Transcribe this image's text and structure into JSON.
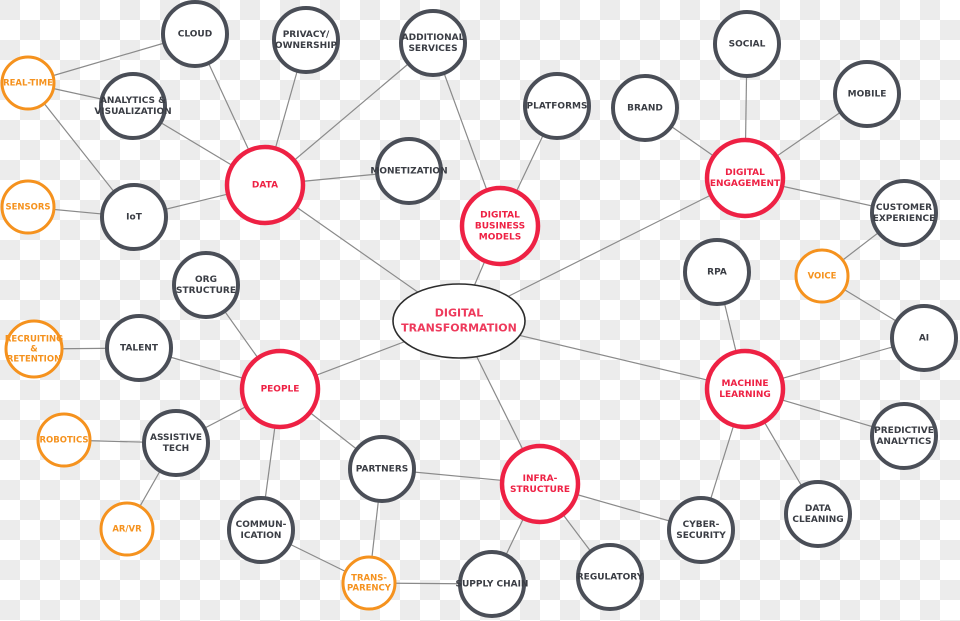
{
  "title": "Digital Transformation",
  "colors": {
    "hub": "#ee2144",
    "topic": "#4a4e57",
    "detail": "#f5921e",
    "center_text": "#ee3a5c",
    "edge": "#8a8a8a"
  },
  "nodes": [
    {
      "id": "digital-transformation",
      "type": "center",
      "lines": [
        "DIGITAL",
        "TRANSFORMATION"
      ]
    },
    {
      "id": "data",
      "type": "hub",
      "lines": [
        "DATA"
      ]
    },
    {
      "id": "digital-business-models",
      "type": "hub",
      "lines": [
        "DIGITAL",
        "BUSINESS",
        "MODELS"
      ]
    },
    {
      "id": "digital-engagement",
      "type": "hub",
      "lines": [
        "DIGITAL",
        "ENGAGEMENT"
      ]
    },
    {
      "id": "people",
      "type": "hub",
      "lines": [
        "PEOPLE"
      ]
    },
    {
      "id": "machine-learning",
      "type": "hub",
      "lines": [
        "MACHINE",
        "LEARNING"
      ]
    },
    {
      "id": "infrastructure",
      "type": "hub",
      "lines": [
        "INFRA-",
        "STRUCTURE"
      ]
    },
    {
      "id": "cloud",
      "type": "topic",
      "lines": [
        "CLOUD"
      ]
    },
    {
      "id": "privacy-ownership",
      "type": "topic",
      "lines": [
        "PRIVACY/",
        "OWNERSHIP"
      ]
    },
    {
      "id": "additional-services",
      "type": "topic",
      "lines": [
        "ADDITIONAL",
        "SERVICES"
      ]
    },
    {
      "id": "analytics-visualization",
      "type": "topic",
      "lines": [
        "ANALYTICS &",
        "VISUALIZATION"
      ]
    },
    {
      "id": "iot",
      "type": "topic",
      "lines": [
        "IoT"
      ]
    },
    {
      "id": "monetization",
      "type": "topic",
      "lines": [
        "MONETIZATION"
      ]
    },
    {
      "id": "platforms",
      "type": "topic",
      "lines": [
        "PLATFORMS"
      ]
    },
    {
      "id": "brand",
      "type": "topic",
      "lines": [
        "BRAND"
      ]
    },
    {
      "id": "social",
      "type": "topic",
      "lines": [
        "SOCIAL"
      ]
    },
    {
      "id": "mobile",
      "type": "topic",
      "lines": [
        "MOBILE"
      ]
    },
    {
      "id": "customer-experience",
      "type": "topic",
      "lines": [
        "CUSTOMER",
        "EXPERIENCE"
      ]
    },
    {
      "id": "rpa",
      "type": "topic",
      "lines": [
        "RPA"
      ]
    },
    {
      "id": "ai",
      "type": "topic",
      "lines": [
        "AI"
      ]
    },
    {
      "id": "predictive-analytics",
      "type": "topic",
      "lines": [
        "PREDICTIVE",
        "ANALYTICS"
      ]
    },
    {
      "id": "data-cleaning",
      "type": "topic",
      "lines": [
        "DATA",
        "CLEANING"
      ]
    },
    {
      "id": "cyber-security",
      "type": "topic",
      "lines": [
        "CYBER-",
        "SECURITY"
      ]
    },
    {
      "id": "regulatory",
      "type": "topic",
      "lines": [
        "REGULATORY"
      ]
    },
    {
      "id": "supply-chain",
      "type": "topic",
      "lines": [
        "SUPPLY CHAIN"
      ]
    },
    {
      "id": "partners",
      "type": "topic",
      "lines": [
        "PARTNERS"
      ]
    },
    {
      "id": "communication",
      "type": "topic",
      "lines": [
        "COMMUN-",
        "ICATION"
      ]
    },
    {
      "id": "assistive-tech",
      "type": "topic",
      "lines": [
        "ASSISTIVE",
        "TECH"
      ]
    },
    {
      "id": "talent",
      "type": "topic",
      "lines": [
        "TALENT"
      ]
    },
    {
      "id": "org-structure",
      "type": "topic",
      "lines": [
        "ORG",
        "STRUCTURE"
      ]
    },
    {
      "id": "real-time",
      "type": "detail",
      "lines": [
        "REAL-TIME"
      ]
    },
    {
      "id": "sensors",
      "type": "detail",
      "lines": [
        "SENSORS"
      ]
    },
    {
      "id": "recruiting-retention",
      "type": "detail",
      "lines": [
        "RECRUITING",
        "&",
        "RETENTION"
      ]
    },
    {
      "id": "robotics",
      "type": "detail",
      "lines": [
        "ROBOTICS"
      ]
    },
    {
      "id": "ar-vr",
      "type": "detail",
      "lines": [
        "AR/VR"
      ]
    },
    {
      "id": "transparency",
      "type": "detail",
      "lines": [
        "TRANS-",
        "PARENCY"
      ]
    },
    {
      "id": "voice",
      "type": "detail",
      "lines": [
        "VOICE"
      ]
    }
  ],
  "edges": [
    [
      "digital-transformation",
      "data"
    ],
    [
      "digital-transformation",
      "digital-business-models"
    ],
    [
      "digital-transformation",
      "digital-engagement"
    ],
    [
      "digital-transformation",
      "people"
    ],
    [
      "digital-transformation",
      "machine-learning"
    ],
    [
      "digital-transformation",
      "infrastructure"
    ],
    [
      "data",
      "cloud"
    ],
    [
      "data",
      "privacy-ownership"
    ],
    [
      "data",
      "additional-services"
    ],
    [
      "data",
      "analytics-visualization"
    ],
    [
      "data",
      "iot"
    ],
    [
      "data",
      "monetization"
    ],
    [
      "real-time",
      "cloud"
    ],
    [
      "real-time",
      "analytics-visualization"
    ],
    [
      "real-time",
      "iot"
    ],
    [
      "sensors",
      "iot"
    ],
    [
      "digital-business-models",
      "additional-services"
    ],
    [
      "digital-business-models",
      "platforms"
    ],
    [
      "digital-engagement",
      "brand"
    ],
    [
      "digital-engagement",
      "social"
    ],
    [
      "digital-engagement",
      "mobile"
    ],
    [
      "digital-engagement",
      "customer-experience"
    ],
    [
      "customer-experience",
      "voice"
    ],
    [
      "voice",
      "ai"
    ],
    [
      "machine-learning",
      "rpa"
    ],
    [
      "machine-learning",
      "ai"
    ],
    [
      "machine-learning",
      "predictive-analytics"
    ],
    [
      "machine-learning",
      "data-cleaning"
    ],
    [
      "machine-learning",
      "cyber-security"
    ],
    [
      "infrastructure",
      "cyber-security"
    ],
    [
      "infrastructure",
      "regulatory"
    ],
    [
      "infrastructure",
      "supply-chain"
    ],
    [
      "infrastructure",
      "partners"
    ],
    [
      "people",
      "org-structure"
    ],
    [
      "people",
      "talent"
    ],
    [
      "people",
      "assistive-tech"
    ],
    [
      "people",
      "communication"
    ],
    [
      "people",
      "partners"
    ],
    [
      "recruiting-retention",
      "talent"
    ],
    [
      "robotics",
      "assistive-tech"
    ],
    [
      "ar-vr",
      "assistive-tech"
    ],
    [
      "partners",
      "transparency"
    ],
    [
      "communication",
      "transparency"
    ],
    [
      "transparency",
      "supply-chain"
    ]
  ]
}
